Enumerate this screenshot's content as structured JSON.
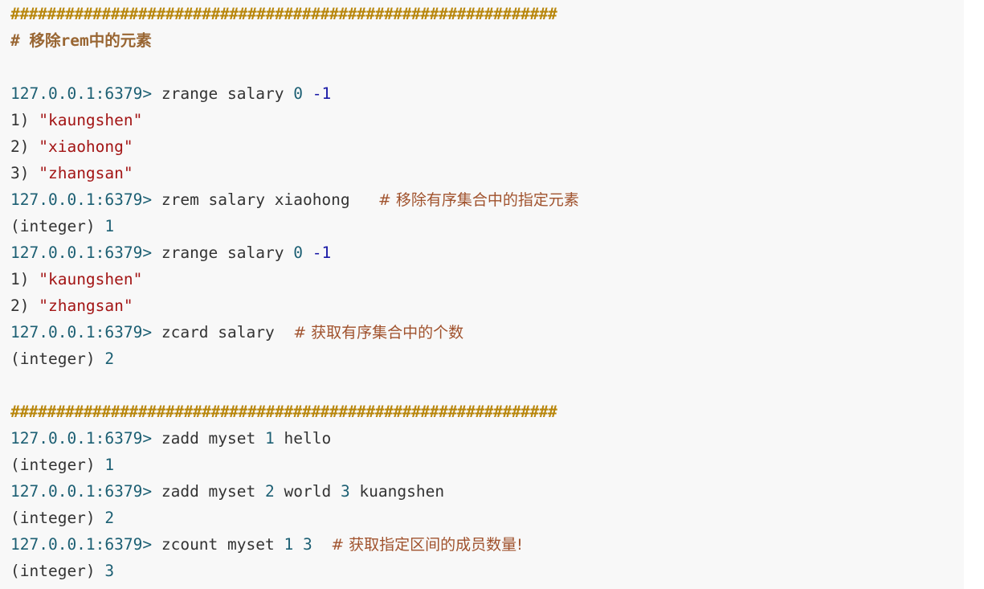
{
  "code_block": {
    "lines": [
      {
        "tokens": [
          {
            "t": "hash",
            "v": "############################################################"
          }
        ]
      },
      {
        "tokens": [
          {
            "t": "cm",
            "v": "# 移除rem中的元素"
          }
        ]
      },
      {
        "tokens": []
      },
      {
        "tokens": [
          {
            "t": "p",
            "v": "127.0.0.1:6379>"
          },
          {
            "t": "x",
            "v": " zrange salary "
          },
          {
            "t": "n",
            "v": "0"
          },
          {
            "t": "x",
            "v": " "
          },
          {
            "t": "neg",
            "v": "-1"
          }
        ]
      },
      {
        "tokens": [
          {
            "t": "x",
            "v": "1) "
          },
          {
            "t": "s",
            "v": "\"kaungshen\""
          }
        ]
      },
      {
        "tokens": [
          {
            "t": "x",
            "v": "2) "
          },
          {
            "t": "s",
            "v": "\"xiaohong\""
          }
        ]
      },
      {
        "tokens": [
          {
            "t": "x",
            "v": "3) "
          },
          {
            "t": "s",
            "v": "\"zhangsan\""
          }
        ]
      },
      {
        "tokens": [
          {
            "t": "p",
            "v": "127.0.0.1:6379>"
          },
          {
            "t": "x",
            "v": " zrem salary xiaohong   "
          },
          {
            "t": "c",
            "v": "# 移除有序集合中的指定元素"
          }
        ]
      },
      {
        "tokens": [
          {
            "t": "x",
            "v": "(integer) "
          },
          {
            "t": "n",
            "v": "1"
          }
        ]
      },
      {
        "tokens": [
          {
            "t": "p",
            "v": "127.0.0.1:6379>"
          },
          {
            "t": "x",
            "v": " zrange salary "
          },
          {
            "t": "n",
            "v": "0"
          },
          {
            "t": "x",
            "v": " "
          },
          {
            "t": "neg",
            "v": "-1"
          }
        ]
      },
      {
        "tokens": [
          {
            "t": "x",
            "v": "1) "
          },
          {
            "t": "s",
            "v": "\"kaungshen\""
          }
        ]
      },
      {
        "tokens": [
          {
            "t": "x",
            "v": "2) "
          },
          {
            "t": "s",
            "v": "\"zhangsan\""
          }
        ]
      },
      {
        "tokens": [
          {
            "t": "p",
            "v": "127.0.0.1:6379>"
          },
          {
            "t": "x",
            "v": " zcard salary  "
          },
          {
            "t": "c",
            "v": "# 获取有序集合中的个数"
          }
        ]
      },
      {
        "tokens": [
          {
            "t": "x",
            "v": "(integer) "
          },
          {
            "t": "n",
            "v": "2"
          }
        ]
      },
      {
        "tokens": []
      },
      {
        "tokens": [
          {
            "t": "hash",
            "v": "############################################################"
          }
        ]
      },
      {
        "tokens": [
          {
            "t": "p",
            "v": "127.0.0.1:6379>"
          },
          {
            "t": "x",
            "v": " zadd myset "
          },
          {
            "t": "n",
            "v": "1"
          },
          {
            "t": "x",
            "v": " hello"
          }
        ]
      },
      {
        "tokens": [
          {
            "t": "x",
            "v": "(integer) "
          },
          {
            "t": "n",
            "v": "1"
          }
        ]
      },
      {
        "tokens": [
          {
            "t": "p",
            "v": "127.0.0.1:6379>"
          },
          {
            "t": "x",
            "v": " zadd myset "
          },
          {
            "t": "n",
            "v": "2"
          },
          {
            "t": "x",
            "v": " world "
          },
          {
            "t": "n",
            "v": "3"
          },
          {
            "t": "x",
            "v": " kuangshen"
          }
        ]
      },
      {
        "tokens": [
          {
            "t": "x",
            "v": "(integer) "
          },
          {
            "t": "n",
            "v": "2"
          }
        ]
      },
      {
        "tokens": [
          {
            "t": "p",
            "v": "127.0.0.1:6379>"
          },
          {
            "t": "x",
            "v": " zcount myset "
          },
          {
            "t": "n",
            "v": "1"
          },
          {
            "t": "x",
            "v": " "
          },
          {
            "t": "n",
            "v": "3"
          },
          {
            "t": "x",
            "v": "  "
          },
          {
            "t": "c",
            "v": "# 获取指定区间的成员数量!"
          }
        ]
      },
      {
        "tokens": [
          {
            "t": "x",
            "v": "(integer) "
          },
          {
            "t": "n",
            "v": "3"
          }
        ]
      }
    ]
  },
  "colors": {
    "background": "#f8f8f8",
    "prompt": "#1c5f73",
    "string": "#a31515",
    "comment": "#a0522d",
    "hash_line": "#b8860b"
  }
}
